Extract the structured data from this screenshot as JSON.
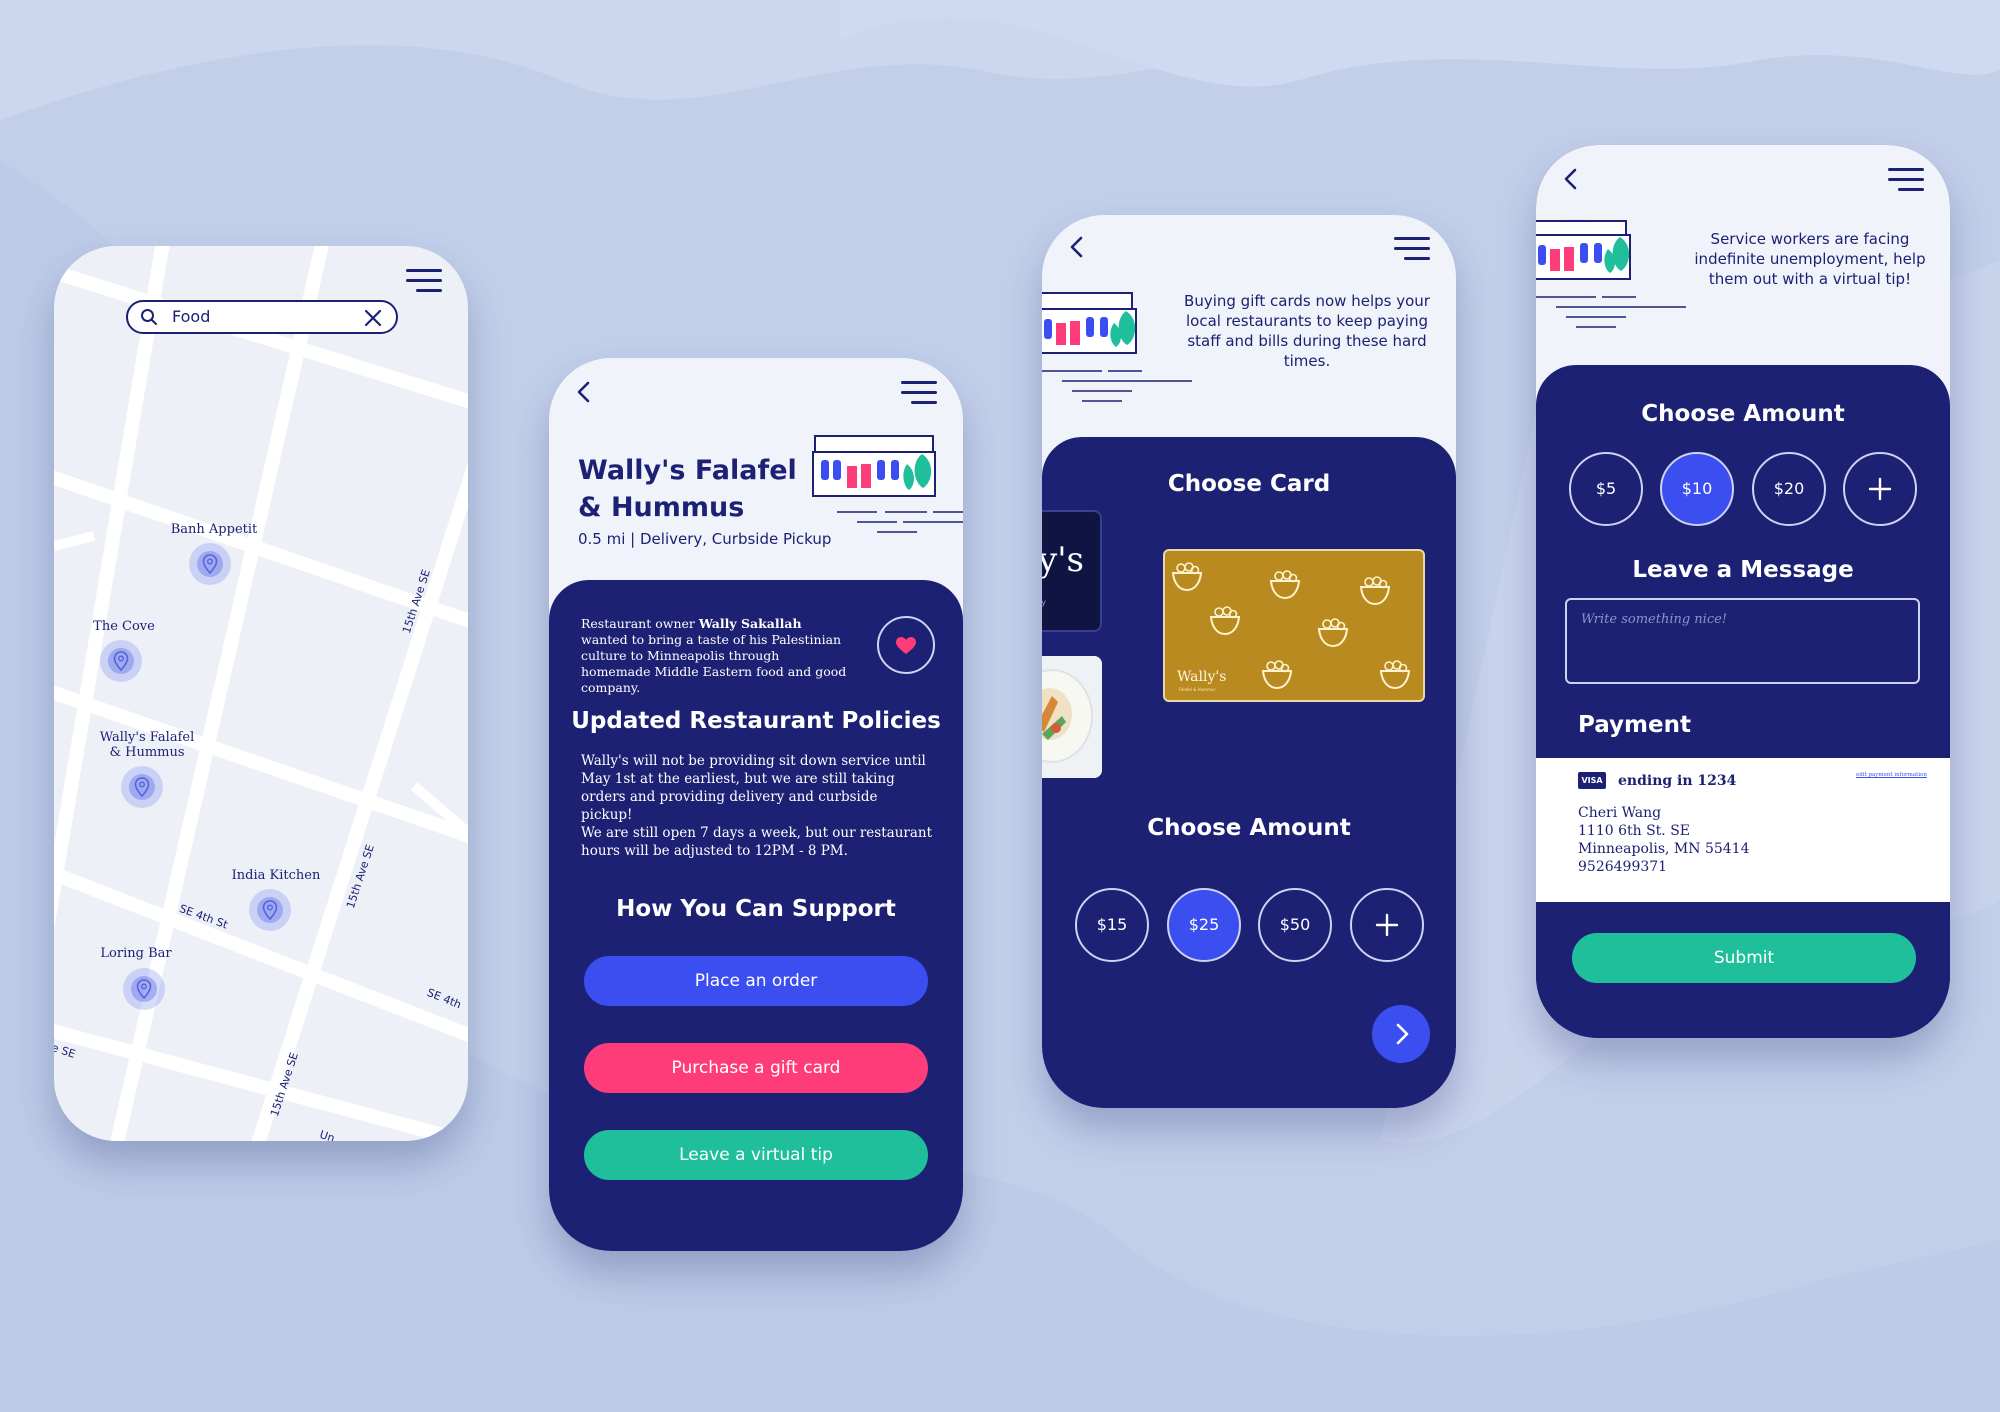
{
  "colors": {
    "background": "#c2cfe9",
    "navy": "#1c2174",
    "phone_light": "#f1f3fb",
    "accent_blue": "#3b4ef0",
    "accent_pink": "#ff3c7a",
    "accent_teal": "#1fbf9c",
    "gold_card": "#b98a1f"
  },
  "map_screen": {
    "search_value": "Food",
    "search_icon": "search-icon",
    "clear_icon": "close-icon",
    "menu_icon": "hamburger-menu-icon",
    "pins": [
      {
        "label": "Banh Appetit"
      },
      {
        "label": "The Cove"
      },
      {
        "label": "Wally's Falafel & Hummus"
      },
      {
        "label": "India Kitchen"
      },
      {
        "label": "Loring Bar"
      }
    ],
    "streets": {
      "s1": "15th Ave SE",
      "s2": "15th Ave SE",
      "s3": "SE 4th St",
      "s4": "SE 4th",
      "s5": "e SE",
      "s6": "15th Ave SE",
      "s7": "Un"
    }
  },
  "restaurant_screen": {
    "back_icon": "chevron-left-icon",
    "menu_icon": "hamburger-menu-icon",
    "title_line1": "Wally's Falafel",
    "title_line2": "& Hummus",
    "subtitle": "0.5 mi | Delivery, Curbside Pickup",
    "story_prefix": "Restaurant owner ",
    "story_owner": "Wally Sakallah",
    "story_suffix": " wanted to bring a taste of his Palestinian culture to Minneapolis through homemade Middle Eastern food and good company.",
    "favorite_icon": "heart-icon",
    "policies_heading": "Updated Restaurant Policies",
    "policy_p1": "Wally's will not be providing sit down service until May 1st at the earliest, but we are still taking orders and providing delivery and curbside pickup!",
    "policy_p2": "We are still open 7 days a week, but our restaurant hours will be adjusted to 12PM - 8 PM.",
    "support_heading": "How You Can Support",
    "buttons": {
      "order": "Place an order",
      "gift": "Purchase a gift card",
      "tip": "Leave a virtual tip"
    }
  },
  "gift_screen": {
    "back_icon": "chevron-left-icon",
    "menu_icon": "hamburger-menu-icon",
    "intro": "Buying gift cards now helps your local restaurants to keep paying staff and bills during these hard times.",
    "choose_card": "Choose Card",
    "partial_card_text": "y's",
    "partial_card_sub": "ry",
    "gold_card_brand": "Wally's",
    "gold_card_small": "Falafel & Hummus",
    "choose_amount": "Choose Amount",
    "amounts": [
      "$15",
      "$25",
      "$50"
    ],
    "selected_amount": "$25",
    "add_icon": "plus-icon",
    "next_icon": "chevron-right-icon"
  },
  "tip_screen": {
    "back_icon": "chevron-left-icon",
    "menu_icon": "hamburger-menu-icon",
    "intro": "Service workers are facing indefinite unemployment, help them out with a virtual tip!",
    "choose_amount": "Choose Amount",
    "amounts": [
      "$5",
      "$10",
      "$20"
    ],
    "selected_amount": "$10",
    "add_icon": "plus-icon",
    "message_heading": "Leave a Message",
    "message_placeholder": "Write something nice!",
    "payment_heading": "Payment",
    "card_brand": "VISA",
    "card_ending": "ending in 1234",
    "edit_link": "edit payment information",
    "name": "Cheri Wang",
    "address1": "1110 6th St. SE",
    "address2": "Minneapolis, MN 55414",
    "phone": "9526499371",
    "submit": "Submit"
  }
}
